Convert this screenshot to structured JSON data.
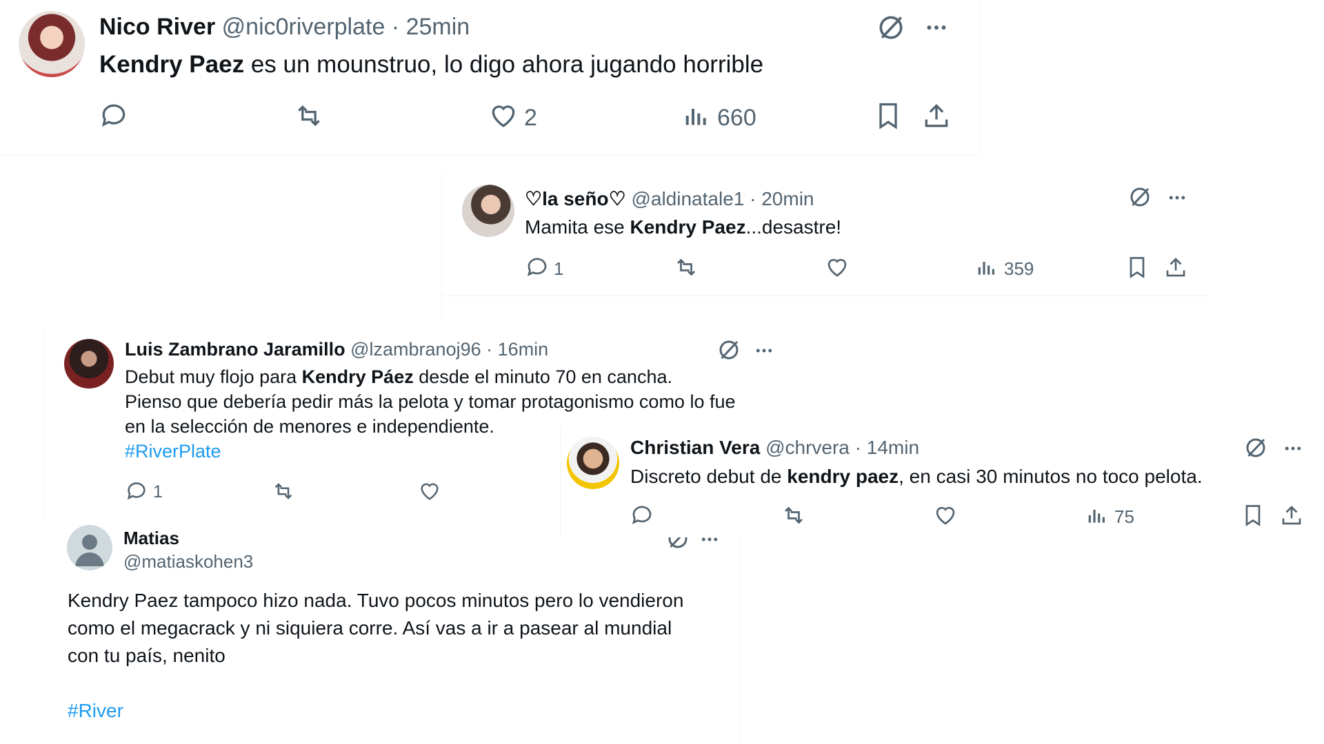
{
  "colors": {
    "text": "#0f1419",
    "muted": "#536471",
    "link": "#1d9bf0"
  },
  "tweet1": {
    "name": "Nico River",
    "handle": "@nic0riverplate",
    "dot": "·",
    "time": "25min",
    "text_bold": "Kendry Paez",
    "text_rest": " es un mounstruo, lo digo ahora jugando horrible",
    "likes": "2",
    "views": "660"
  },
  "tweet2": {
    "name": "♡la seño♡",
    "handle": "@aldinatale1",
    "dot": "·",
    "time": "20min",
    "text_pre": "Mamita ese ",
    "text_bold": "Kendry Paez",
    "text_post": "...desastre!",
    "replies": "1",
    "views": "359"
  },
  "tweet3": {
    "name": "Luis Zambrano Jaramillo",
    "handle": "@lzambranoj96",
    "dot": "·",
    "time": "16min",
    "line1_pre": "Debut muy flojo para ",
    "line1_bold": "Kendry Páez",
    "line1_post": " desde el minuto 70 en cancha.",
    "line2": "Pienso que debería pedir más la pelota y tomar protagonismo como lo fue",
    "line3": "en la selección de menores e independiente.",
    "hashtag": "#RiverPlate",
    "replies": "1"
  },
  "tweet4": {
    "name": "Christian Vera",
    "handle": "@chrvera",
    "dot": "·",
    "time": "14min",
    "text_pre": "Discreto debut de ",
    "text_bold": "kendry paez",
    "text_post": ", en casi 30 minutos no toco pelota.",
    "views": "75"
  },
  "tweet5": {
    "name": "Matias",
    "handle": "@matiaskohen3",
    "line1": "Kendry Paez tampoco hizo nada. Tuvo pocos minutos pero lo vendieron",
    "line2": "como el megacrack y ni siquiera corre. Así vas a ir a pasear al mundial",
    "line3": "con tu país, nenito",
    "hashtag": "#River"
  }
}
